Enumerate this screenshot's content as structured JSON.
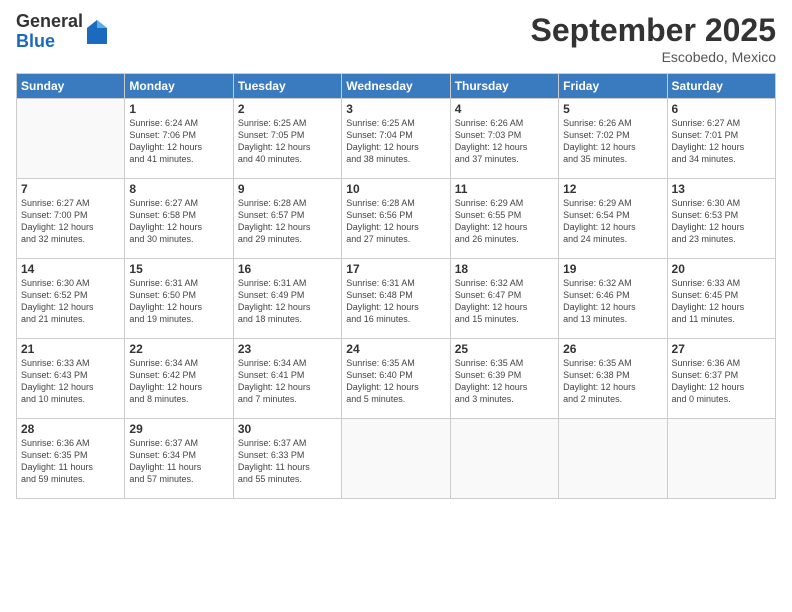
{
  "logo": {
    "general": "General",
    "blue": "Blue"
  },
  "title": "September 2025",
  "location": "Escobedo, Mexico",
  "days_of_week": [
    "Sunday",
    "Monday",
    "Tuesday",
    "Wednesday",
    "Thursday",
    "Friday",
    "Saturday"
  ],
  "weeks": [
    [
      {
        "day": "",
        "info": ""
      },
      {
        "day": "1",
        "info": "Sunrise: 6:24 AM\nSunset: 7:06 PM\nDaylight: 12 hours\nand 41 minutes."
      },
      {
        "day": "2",
        "info": "Sunrise: 6:25 AM\nSunset: 7:05 PM\nDaylight: 12 hours\nand 40 minutes."
      },
      {
        "day": "3",
        "info": "Sunrise: 6:25 AM\nSunset: 7:04 PM\nDaylight: 12 hours\nand 38 minutes."
      },
      {
        "day": "4",
        "info": "Sunrise: 6:26 AM\nSunset: 7:03 PM\nDaylight: 12 hours\nand 37 minutes."
      },
      {
        "day": "5",
        "info": "Sunrise: 6:26 AM\nSunset: 7:02 PM\nDaylight: 12 hours\nand 35 minutes."
      },
      {
        "day": "6",
        "info": "Sunrise: 6:27 AM\nSunset: 7:01 PM\nDaylight: 12 hours\nand 34 minutes."
      }
    ],
    [
      {
        "day": "7",
        "info": "Sunrise: 6:27 AM\nSunset: 7:00 PM\nDaylight: 12 hours\nand 32 minutes."
      },
      {
        "day": "8",
        "info": "Sunrise: 6:27 AM\nSunset: 6:58 PM\nDaylight: 12 hours\nand 30 minutes."
      },
      {
        "day": "9",
        "info": "Sunrise: 6:28 AM\nSunset: 6:57 PM\nDaylight: 12 hours\nand 29 minutes."
      },
      {
        "day": "10",
        "info": "Sunrise: 6:28 AM\nSunset: 6:56 PM\nDaylight: 12 hours\nand 27 minutes."
      },
      {
        "day": "11",
        "info": "Sunrise: 6:29 AM\nSunset: 6:55 PM\nDaylight: 12 hours\nand 26 minutes."
      },
      {
        "day": "12",
        "info": "Sunrise: 6:29 AM\nSunset: 6:54 PM\nDaylight: 12 hours\nand 24 minutes."
      },
      {
        "day": "13",
        "info": "Sunrise: 6:30 AM\nSunset: 6:53 PM\nDaylight: 12 hours\nand 23 minutes."
      }
    ],
    [
      {
        "day": "14",
        "info": "Sunrise: 6:30 AM\nSunset: 6:52 PM\nDaylight: 12 hours\nand 21 minutes."
      },
      {
        "day": "15",
        "info": "Sunrise: 6:31 AM\nSunset: 6:50 PM\nDaylight: 12 hours\nand 19 minutes."
      },
      {
        "day": "16",
        "info": "Sunrise: 6:31 AM\nSunset: 6:49 PM\nDaylight: 12 hours\nand 18 minutes."
      },
      {
        "day": "17",
        "info": "Sunrise: 6:31 AM\nSunset: 6:48 PM\nDaylight: 12 hours\nand 16 minutes."
      },
      {
        "day": "18",
        "info": "Sunrise: 6:32 AM\nSunset: 6:47 PM\nDaylight: 12 hours\nand 15 minutes."
      },
      {
        "day": "19",
        "info": "Sunrise: 6:32 AM\nSunset: 6:46 PM\nDaylight: 12 hours\nand 13 minutes."
      },
      {
        "day": "20",
        "info": "Sunrise: 6:33 AM\nSunset: 6:45 PM\nDaylight: 12 hours\nand 11 minutes."
      }
    ],
    [
      {
        "day": "21",
        "info": "Sunrise: 6:33 AM\nSunset: 6:43 PM\nDaylight: 12 hours\nand 10 minutes."
      },
      {
        "day": "22",
        "info": "Sunrise: 6:34 AM\nSunset: 6:42 PM\nDaylight: 12 hours\nand 8 minutes."
      },
      {
        "day": "23",
        "info": "Sunrise: 6:34 AM\nSunset: 6:41 PM\nDaylight: 12 hours\nand 7 minutes."
      },
      {
        "day": "24",
        "info": "Sunrise: 6:35 AM\nSunset: 6:40 PM\nDaylight: 12 hours\nand 5 minutes."
      },
      {
        "day": "25",
        "info": "Sunrise: 6:35 AM\nSunset: 6:39 PM\nDaylight: 12 hours\nand 3 minutes."
      },
      {
        "day": "26",
        "info": "Sunrise: 6:35 AM\nSunset: 6:38 PM\nDaylight: 12 hours\nand 2 minutes."
      },
      {
        "day": "27",
        "info": "Sunrise: 6:36 AM\nSunset: 6:37 PM\nDaylight: 12 hours\nand 0 minutes."
      }
    ],
    [
      {
        "day": "28",
        "info": "Sunrise: 6:36 AM\nSunset: 6:35 PM\nDaylight: 11 hours\nand 59 minutes."
      },
      {
        "day": "29",
        "info": "Sunrise: 6:37 AM\nSunset: 6:34 PM\nDaylight: 11 hours\nand 57 minutes."
      },
      {
        "day": "30",
        "info": "Sunrise: 6:37 AM\nSunset: 6:33 PM\nDaylight: 11 hours\nand 55 minutes."
      },
      {
        "day": "",
        "info": ""
      },
      {
        "day": "",
        "info": ""
      },
      {
        "day": "",
        "info": ""
      },
      {
        "day": "",
        "info": ""
      }
    ]
  ]
}
